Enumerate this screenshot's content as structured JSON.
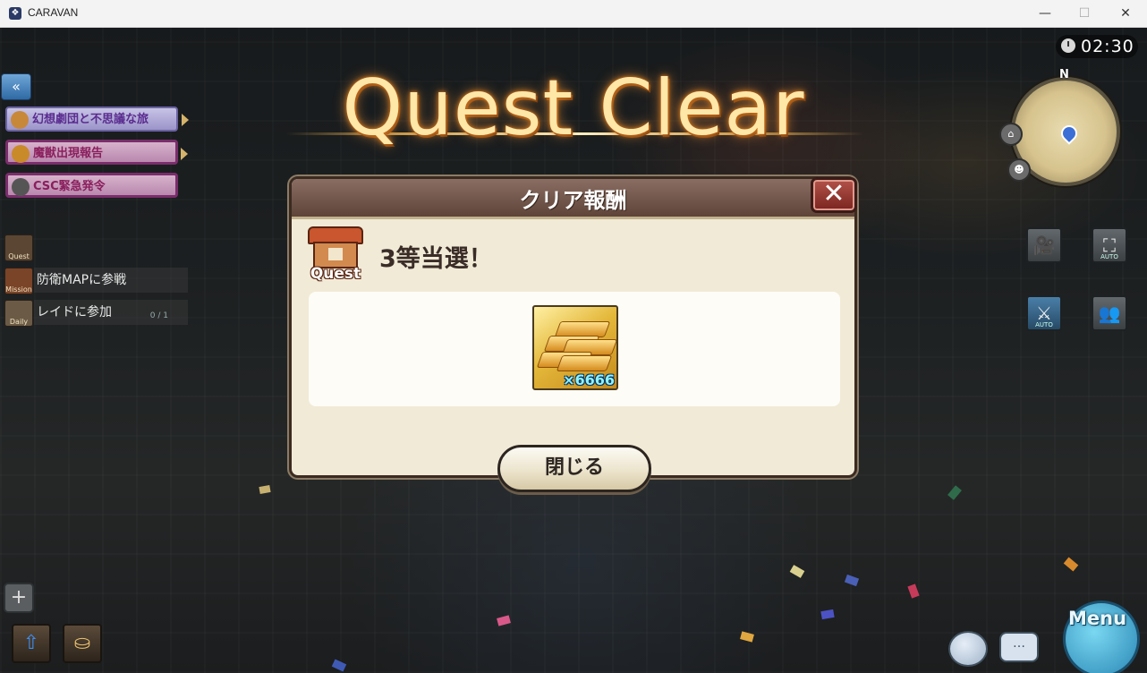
{
  "window": {
    "title": "CARAVAN",
    "app_icon": "caravan-app-icon",
    "controls": {
      "minimize": "—",
      "maximize": "☐",
      "close": "✕"
    }
  },
  "hud": {
    "timer": "02:30",
    "compass": "N",
    "banner": "Quest Clear"
  },
  "quest_list": {
    "items": [
      {
        "label": "幻想劇団と不思議な旅",
        "icon": "mask-icon"
      },
      {
        "label": "魔獣出現報告",
        "icon": "demon-icon"
      },
      {
        "label": "CSC緊急発令",
        "icon": "alert-icon"
      }
    ]
  },
  "missions": {
    "quest_tab": "Quest",
    "rows": [
      {
        "tab": "Mission",
        "label": "防衛MAPに参戦",
        "progress": ""
      },
      {
        "tab": "Daily",
        "label": "レイドに参加",
        "progress": "0 / 1"
      }
    ]
  },
  "right_buttons": {
    "camera_auto": "AUTO",
    "battle_auto": "AUTO"
  },
  "dialog": {
    "title": "クリア報酬",
    "close_icon": "✕",
    "quest_icon_label": "Quest",
    "prize_text": "3等当選！",
    "reward": {
      "item": "gold-ingot-icon",
      "quantity": "×6666"
    },
    "close_button": "閉じる"
  },
  "bottom": {
    "menu_label": "Menu"
  },
  "colors": {
    "dialog_bg": "#f1ead6",
    "dialog_header": "#6e5347",
    "close_red": "#9c3a33",
    "banner_gold": "#ffe7a8"
  }
}
